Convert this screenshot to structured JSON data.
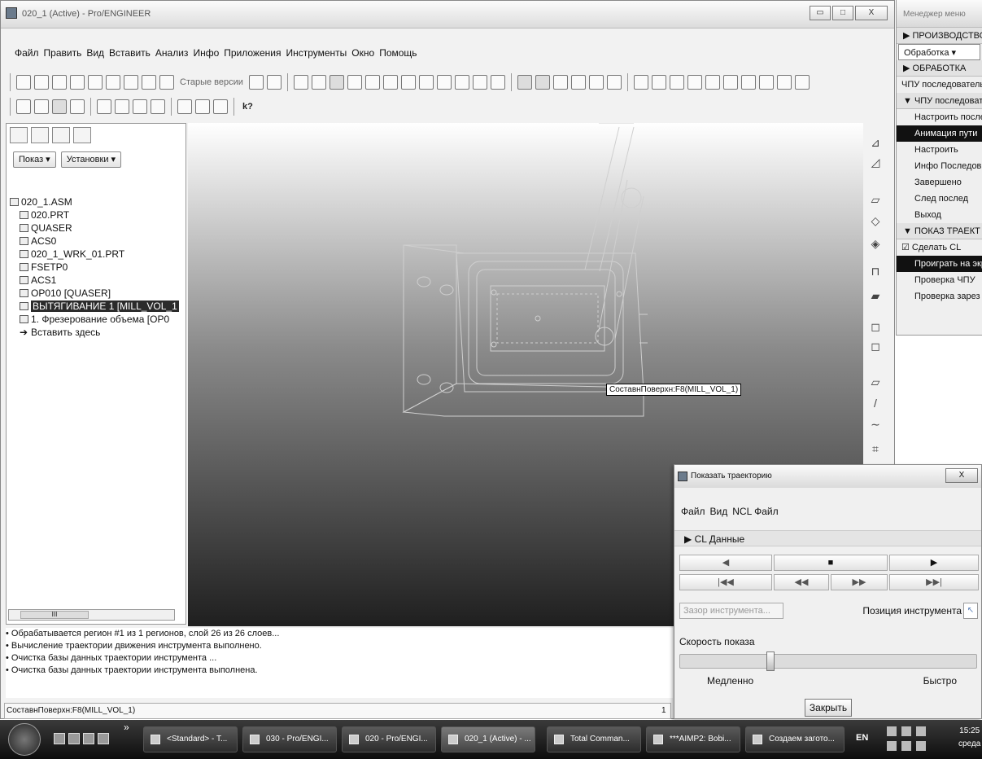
{
  "window": {
    "title": "020_1 (Active) - Pro/ENGINEER",
    "buttons": [
      "▭",
      "□",
      "X"
    ]
  },
  "menubar": [
    "Файл",
    "Править",
    "Вид",
    "Вставить",
    "Анализ",
    "Инфо",
    "Приложения",
    "Инструменты",
    "Окно",
    "Помощь"
  ],
  "toolbar": {
    "old_versions_label": "Старые версии",
    "help_glyph": "k?"
  },
  "left_panel": {
    "show_button": "Показ ▾",
    "settings_button": "Установки ▾",
    "tree": [
      {
        "label": "020_1.ASM",
        "indent": 0
      },
      {
        "label": "020.PRT",
        "indent": 1
      },
      {
        "label": "QUASER",
        "indent": 1
      },
      {
        "label": "ACS0",
        "indent": 1
      },
      {
        "label": "020_1_WRK_01.PRT",
        "indent": 1
      },
      {
        "label": "FSETP0",
        "indent": 1
      },
      {
        "label": "ACS1",
        "indent": 1
      },
      {
        "label": "OP010 [QUASER]",
        "indent": 1
      },
      {
        "label": "ВЫТЯГИВАНИЕ 1 [MILL_VOL_1",
        "indent": 1,
        "selected": true
      },
      {
        "label": "1. Фрезерование объема [OP0",
        "indent": 1
      },
      {
        "label": "Вставить здесь",
        "indent": 1
      }
    ],
    "scroll_thumb": "III"
  },
  "viewport": {
    "tooltip": "СоставнПоверхн:F8(MILL_VOL_1)"
  },
  "messages": [
    "• Обрабатывается регион #1 из 1 регионов, слой 26 из 26 слоев...",
    "• Вычисление траектории движения инструмента выполнено.",
    "• Очистка базы данных траектории инструмента ...",
    "• Очистка базы данных траектории инструмента выполнена."
  ],
  "statusbar": {
    "text": "СоставнПоверхн:F8(MILL_VOL_1)",
    "right": "1"
  },
  "menu_manager": {
    "title": "Менеджер меню",
    "rows": [
      {
        "text": "▶ ПРОИЗВОДСТВО",
        "kind": "head"
      },
      {
        "text": "Обработка ▾",
        "kind": "select"
      },
      {
        "text": "▶ ОБРАБОТКА",
        "kind": "head"
      },
      {
        "text": "ЧПУ последовательность",
        "kind": "plain"
      },
      {
        "text": "▼ ЧПУ последовательность",
        "kind": "head"
      },
      {
        "text": "Настроить послед",
        "kind": "item"
      },
      {
        "text": "Анимация пути",
        "kind": "item",
        "highlight": true
      },
      {
        "text": "Настроить",
        "kind": "item"
      },
      {
        "text": "Инфо Последов",
        "kind": "item"
      },
      {
        "text": "Завершено",
        "kind": "item"
      },
      {
        "text": "След послед",
        "kind": "item"
      },
      {
        "text": "Выход",
        "kind": "item"
      },
      {
        "text": "▼ ПОКАЗ ТРАЕКТ",
        "kind": "head"
      },
      {
        "text": "☑ Сделать CL",
        "kind": "plain"
      },
      {
        "text": "Проиграть на экране",
        "kind": "item",
        "highlight": true
      },
      {
        "text": "Проверка ЧПУ",
        "kind": "item"
      },
      {
        "text": "Проверка зарез",
        "kind": "item"
      }
    ]
  },
  "dialog": {
    "title": "Показать траекторию",
    "close_x": "X",
    "menu": [
      "Файл",
      "Вид",
      "NCL Файл"
    ],
    "section": "▶ CL Данные",
    "play_back": "◀",
    "stop": "■",
    "play_fwd": "▶",
    "to_start": "|◀◀",
    "rewind": "◀◀",
    "ffwd": "▶▶",
    "to_end": "▶▶|",
    "tool_gap": "Зазор инструмента...",
    "tool_position": "Позиция инструмента",
    "pointer_glyph": "↖",
    "speed_label": "Скорость показа",
    "speed_value": 0.3,
    "slow": "Медленно",
    "fast": "Быстро",
    "close": "Закрыть"
  },
  "taskbar": {
    "more": "»",
    "tasks": [
      "<Standard> - T...",
      "030 - Pro/ENGI...",
      "020 - Pro/ENGI...",
      "020_1 (Active) - ...",
      "Total Comman...",
      "***AIMP2: Bobi...",
      "Создаем загото..."
    ],
    "lang": "EN",
    "time": "15:25",
    "day": "среда"
  }
}
